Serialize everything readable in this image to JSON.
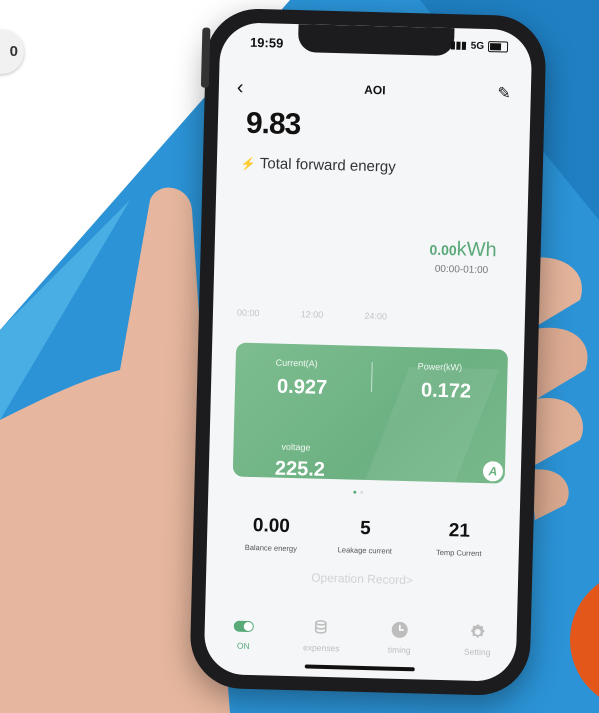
{
  "corner_badge": "0",
  "status": {
    "time": "19:59",
    "network": "5G"
  },
  "nav": {
    "back": "‹",
    "title": "AOI",
    "edit": "✎"
  },
  "energy": {
    "total": "9.83",
    "label": "Total forward energy"
  },
  "chart_summary": {
    "value": "0.00",
    "unit": "kWh",
    "range": "00:00-01:00"
  },
  "axis_ticks": [
    "00:00",
    "12:00",
    "24:00"
  ],
  "card": {
    "current_label": "Current(A)",
    "current_value": "0.927",
    "power_label": "Power(kW)",
    "power_value": "0.172",
    "voltage_label": "voltage",
    "voltage_value": "225.2",
    "badge": "A"
  },
  "stats": [
    {
      "value": "0.00",
      "label": "Balance energy"
    },
    {
      "value": "5",
      "label": "Leakage current"
    },
    {
      "value": "21",
      "label": "Temp Current"
    }
  ],
  "operation_record": "Operation Record>",
  "tabs": [
    {
      "label": "ON",
      "icon": "toggle-icon"
    },
    {
      "label": "expenses",
      "icon": "coins-icon"
    },
    {
      "label": "timing",
      "icon": "clock-icon"
    },
    {
      "label": "Setting",
      "icon": "gear-icon"
    }
  ],
  "colors": {
    "accent": "#5aa979",
    "card": "#6cb182",
    "bg_blue": "#2a8fcf"
  }
}
